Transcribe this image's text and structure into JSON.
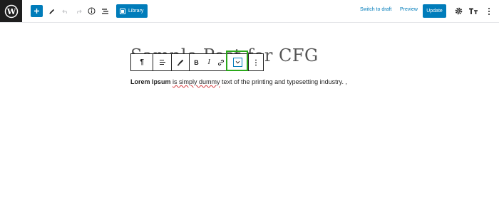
{
  "header": {
    "library_label": "Library",
    "switch_to_draft_label": "Switch to draft",
    "preview_label": "Preview",
    "update_label": "Update"
  },
  "editor": {
    "title_text": "Sample Post for CFG",
    "paragraph": {
      "bold_text": "Lorem Ipsum",
      "space1": " ",
      "misspelled_text": "is simply dummy",
      "rest_text": " text of the printing and typesetting industry. ,"
    }
  },
  "block_toolbar": {
    "paragraph_icon": "¶",
    "bold_label": "B",
    "italic_label": "I"
  },
  "colors": {
    "accent": "#007cba",
    "highlight": "#2aa81a",
    "dark": "#1e1e1e"
  }
}
